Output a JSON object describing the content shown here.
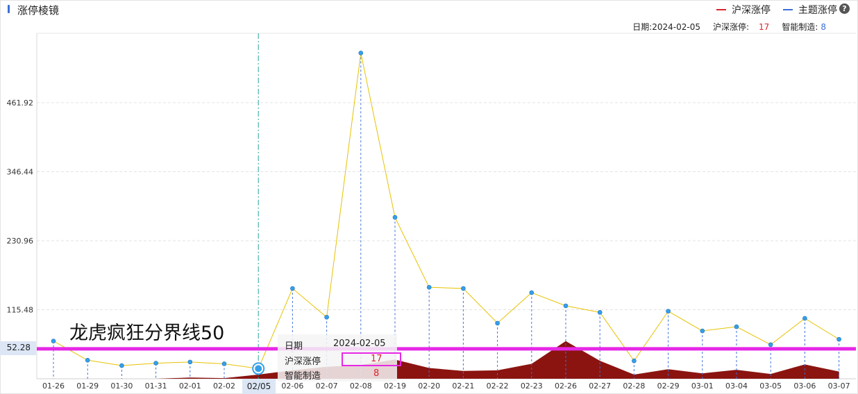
{
  "header": {
    "title": "涨停棱镜",
    "legend": [
      {
        "label": "沪深涨停",
        "color": "#d9232d"
      },
      {
        "label": "主题涨停",
        "color": "#3b6fd8"
      }
    ],
    "help_icon": "question-icon"
  },
  "info": {
    "date_label": "日期:",
    "date_value": "2024-02-05",
    "series1_label": "沪深涨停:",
    "series1_value": "17",
    "series2_label": "智能制造:",
    "series2_value": "8"
  },
  "tooltip": {
    "date_label": "日期",
    "date_value": "2024-02-05",
    "series1_label": "沪深涨停",
    "series1_value": "17",
    "series2_label": "智能制造",
    "series2_value": "8"
  },
  "annotation": {
    "text": "龙虎疯狂分界线50",
    "threshold": 50,
    "color": "#e628e6"
  },
  "crosshair": {
    "x_label": "02/05",
    "y_label": "52.28"
  },
  "chart_data": {
    "type": "line",
    "categories": [
      "01-26",
      "01-29",
      "01-30",
      "01-31",
      "02-01",
      "02-02",
      "02-05",
      "02-06",
      "02-07",
      "02-08",
      "02-19",
      "02-20",
      "02-21",
      "02-22",
      "02-23",
      "02-26",
      "02-27",
      "02-28",
      "02-29",
      "03-01",
      "03-04",
      "03-05",
      "03-06",
      "03-07"
    ],
    "y_ticks": [
      "461.92",
      "346.44",
      "230.96",
      "115.48"
    ],
    "ylim": [
      0,
      600
    ],
    "series": [
      {
        "name": "沪深涨停",
        "kind": "area",
        "color": "#8b1410",
        "values": [
          0,
          0,
          0,
          0,
          2,
          1,
          7,
          14,
          20,
          23,
          32,
          18,
          13,
          14,
          25,
          63,
          30,
          7,
          16,
          9,
          15,
          8,
          24,
          12
        ]
      },
      {
        "name": "主题涨停",
        "kind": "line",
        "color": "#e6c200",
        "marker_color": "#35a0e8",
        "values": [
          63,
          31,
          22,
          26,
          28,
          25,
          17,
          151,
          103,
          545,
          270,
          153,
          151,
          93,
          144,
          122,
          111,
          30,
          113,
          80,
          87,
          57,
          101,
          66
        ]
      }
    ],
    "highlight_category": "02-05",
    "grid": true
  }
}
